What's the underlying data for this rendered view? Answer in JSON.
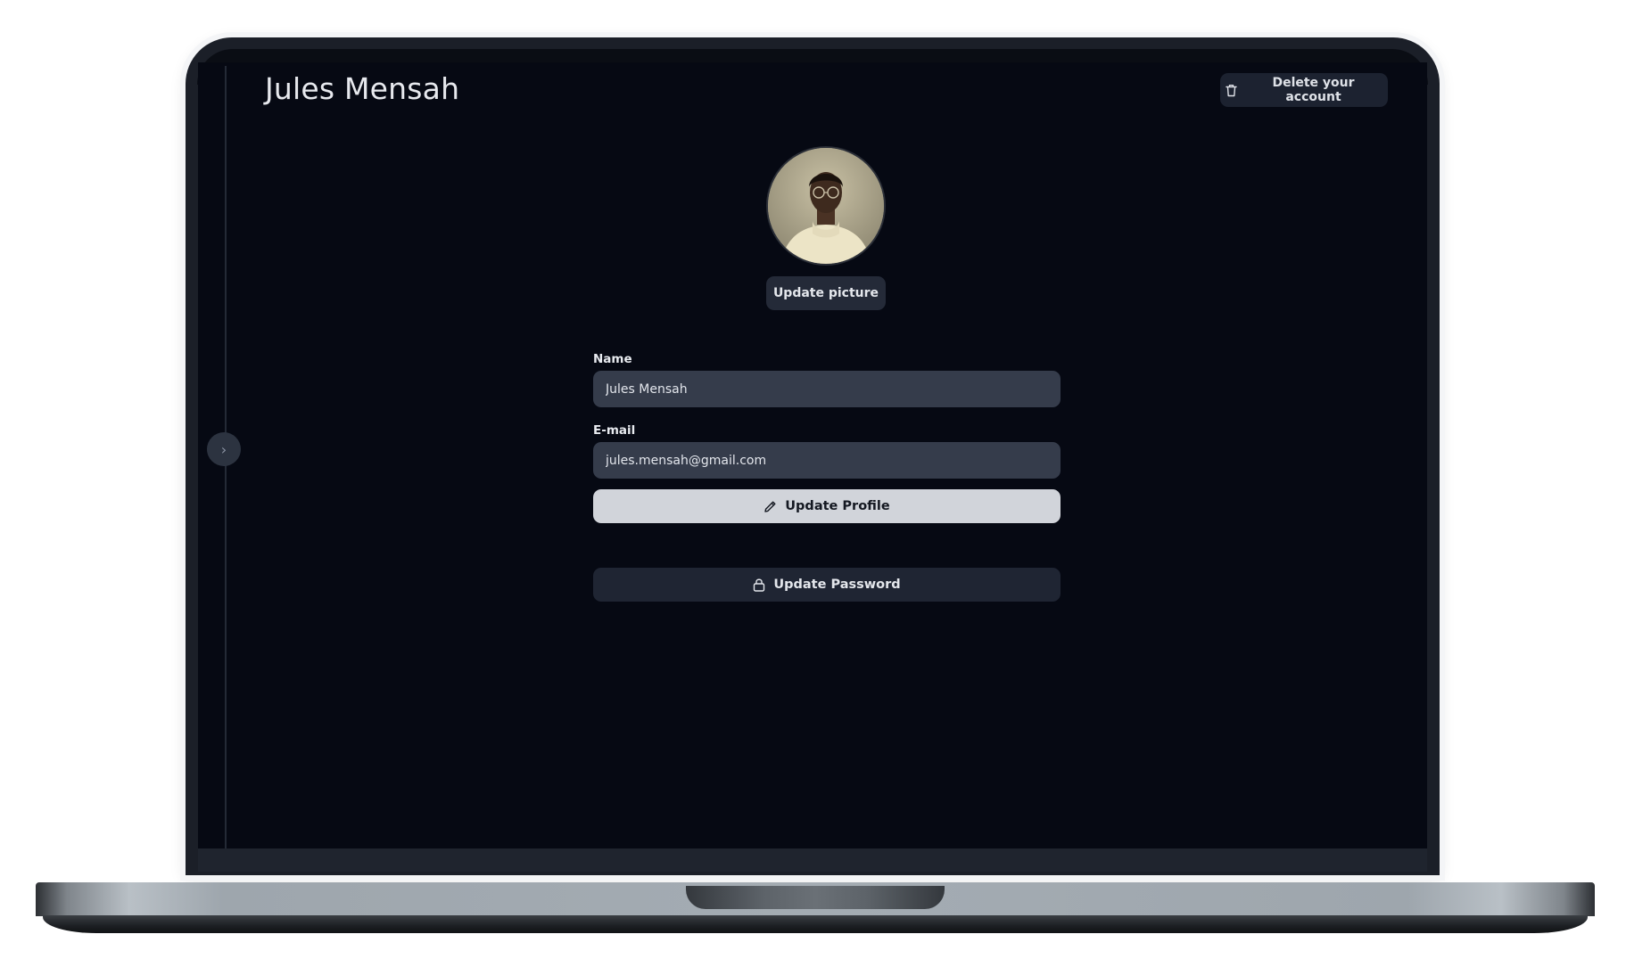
{
  "app": {
    "title": "Jules Mensah"
  },
  "header": {
    "delete_account_label": "Delete your account",
    "delete_icon": "trash-icon"
  },
  "profile": {
    "avatar_alt": "profile-photo",
    "update_picture_label": "Update picture"
  },
  "form": {
    "name_label": "Name",
    "name_value": "Jules Mensah",
    "email_label": "E-mail",
    "email_value": "jules.mensah@gmail.com",
    "update_profile_label": "Update Profile",
    "update_profile_icon": "pencil-icon",
    "update_password_label": "Update Password",
    "update_password_icon": "lock-icon"
  },
  "sidebar": {
    "toggle_icon": "chevron-right-icon",
    "toggle_glyph": "›"
  },
  "colors": {
    "screen_background": "#060913",
    "input_background": "#353c4b",
    "primary_button": "#d1d4da",
    "secondary_button": "#1f2533"
  }
}
